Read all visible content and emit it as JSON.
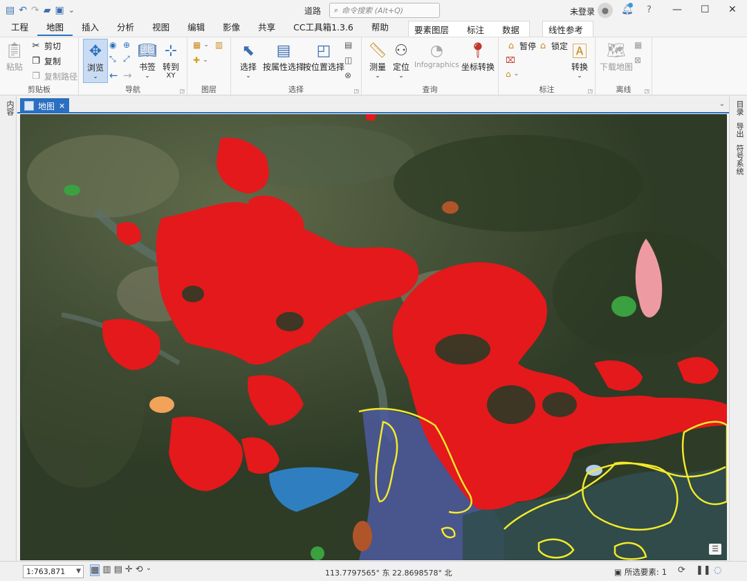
{
  "window": {
    "title": "道路",
    "search_placeholder": "命令搜索 (Alt+Q)",
    "user": "未登录"
  },
  "tabs": [
    "工程",
    "地图",
    "插入",
    "分析",
    "视图",
    "编辑",
    "影像",
    "共享",
    "CC工具箱1.3.6",
    "帮助"
  ],
  "active_tab": "地图",
  "context_tabs": [
    "要素图层",
    "标注",
    "数据"
  ],
  "extra_tab": "线性参考",
  "ribbon": {
    "clipboard": {
      "label": "剪贴板",
      "paste": "粘贴",
      "cut": "剪切",
      "copy": "复制",
      "copy_path": "复制路径"
    },
    "navigate": {
      "label": "导航",
      "explore": "浏览",
      "bookmarks": "书签",
      "goto_line1": "转到",
      "goto_line2": "XY"
    },
    "layer": {
      "label": "图层"
    },
    "selection": {
      "label": "选择",
      "select": "选择",
      "select_by_attr": "按属性选择",
      "select_by_loc": "按位置选择"
    },
    "inquiry": {
      "label": "查询",
      "measure": "测量",
      "locate": "定位",
      "infographics": "Infographics",
      "coord_convert": "坐标转换"
    },
    "labeling": {
      "label": "标注",
      "pause": "暂停",
      "lock": "锁定",
      "convert": "转换"
    },
    "offline": {
      "label": "离线",
      "download": "下载地图"
    }
  },
  "doc_tab": {
    "label": "地图"
  },
  "side_panels": {
    "left": "内容",
    "right": [
      "目录",
      "导出",
      "符号系统"
    ]
  },
  "status": {
    "scale": "1:763,871",
    "coords": "113.7797565° 东 22.8698578° 北",
    "selected_label": "所选要素:",
    "selected_count": "1"
  },
  "colors": {
    "accent": "#2a6fc0",
    "urban": "#e3191c",
    "coast": "#f2ea2a",
    "water": "#3a74b8",
    "forest": "#2f3e27"
  }
}
